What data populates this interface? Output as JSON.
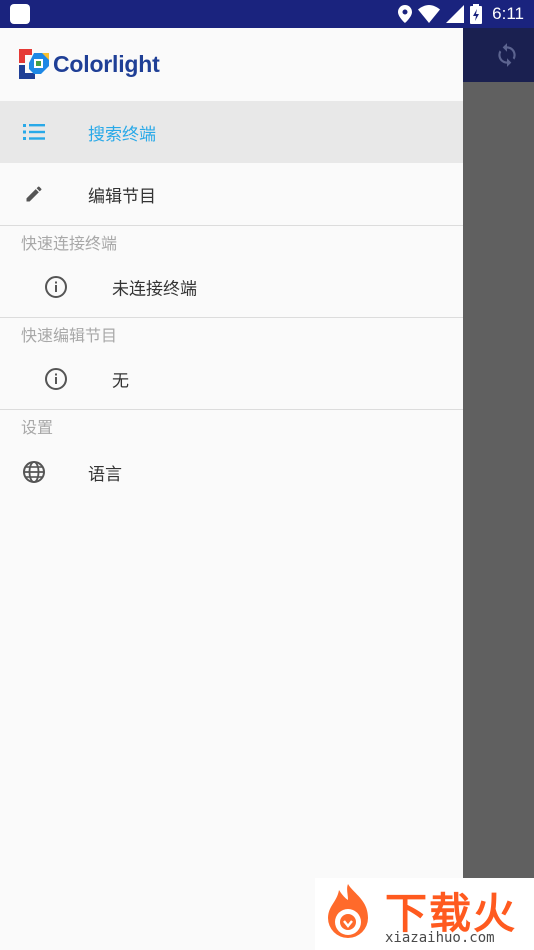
{
  "status_bar": {
    "time": "6:11"
  },
  "app": {
    "brand": "Colorlight"
  },
  "drawer": {
    "items": [
      {
        "label": "搜索终端",
        "icon": "list-icon",
        "active": true
      },
      {
        "label": "编辑节目",
        "icon": "pencil-icon",
        "active": false
      }
    ],
    "sections": [
      {
        "header": "快速连接终端",
        "item": {
          "label": "未连接终端",
          "icon": "info-icon"
        }
      },
      {
        "header": "快速编辑节目",
        "item": {
          "label": "无",
          "icon": "info-icon"
        }
      }
    ],
    "settings": {
      "header": "设置",
      "item": {
        "label": "语言",
        "icon": "globe-icon"
      }
    }
  },
  "watermark": {
    "title": "下载火",
    "subtitle": "xiazaihuo.com"
  },
  "colors": {
    "accent": "#29a9e8",
    "status_bar": "#1a237e",
    "brand": "#1f3f96"
  }
}
